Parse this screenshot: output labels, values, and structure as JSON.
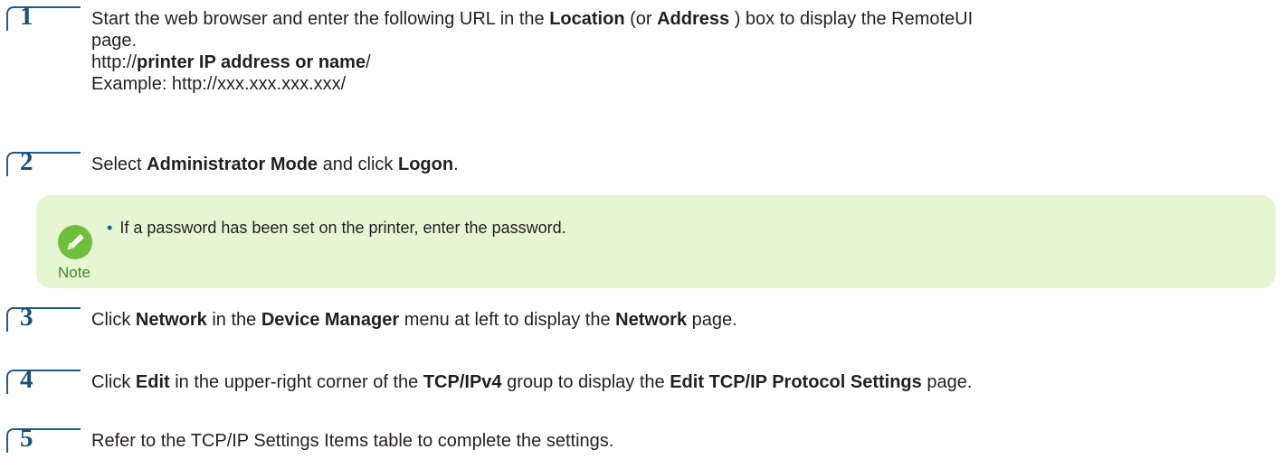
{
  "steps": [
    {
      "num": "1",
      "lines": [
        [
          {
            "t": "Start the web browser and enter the following URL in the "
          },
          {
            "t": "Location",
            "b": true
          },
          {
            "t": " (or "
          },
          {
            "t": "Address",
            "b": true
          },
          {
            "t": " ) box to display the RemoteUI"
          }
        ],
        [
          {
            "t": "page."
          }
        ],
        [
          {
            "t": "http://"
          },
          {
            "t": "printer IP address or name",
            "b": true
          },
          {
            "t": "/"
          }
        ],
        [
          {
            "t": "Example: http://xxx.xxx.xxx.xxx/"
          }
        ]
      ]
    },
    {
      "num": "2",
      "lines": [
        [
          {
            "t": "Select "
          },
          {
            "t": "Administrator Mode",
            "b": true
          },
          {
            "t": " and click "
          },
          {
            "t": "Logon",
            "b": true
          },
          {
            "t": "."
          }
        ]
      ]
    },
    {
      "num": "3",
      "lines": [
        [
          {
            "t": "Click "
          },
          {
            "t": "Network",
            "b": true
          },
          {
            "t": " in the "
          },
          {
            "t": "Device Manager",
            "b": true
          },
          {
            "t": " menu at left to display the "
          },
          {
            "t": "Network",
            "b": true
          },
          {
            "t": " page."
          }
        ]
      ]
    },
    {
      "num": "4",
      "lines": [
        [
          {
            "t": "Click "
          },
          {
            "t": "Edit",
            "b": true
          },
          {
            "t": " in the upper-right corner of the "
          },
          {
            "t": "TCP/IPv4",
            "b": true
          },
          {
            "t": " group to display the "
          },
          {
            "t": "Edit TCP/IP Protocol Settings",
            "b": true
          },
          {
            "t": " page."
          }
        ]
      ]
    },
    {
      "num": "5",
      "lines": [
        [
          {
            "t": "Refer to the TCP/IP Settings Items table to complete the settings."
          }
        ]
      ]
    }
  ],
  "note": {
    "label": "Note",
    "icon": "note-pencil-icon",
    "bullet": "•",
    "text": "If a password has been set on the printer, enter the password."
  },
  "colors": {
    "step_border": "#1f5c8a",
    "step_number": "#1b4f7a",
    "note_bg": "#e6f5d2",
    "note_icon": "#6fbe3c",
    "note_label": "#3d8c1f"
  }
}
